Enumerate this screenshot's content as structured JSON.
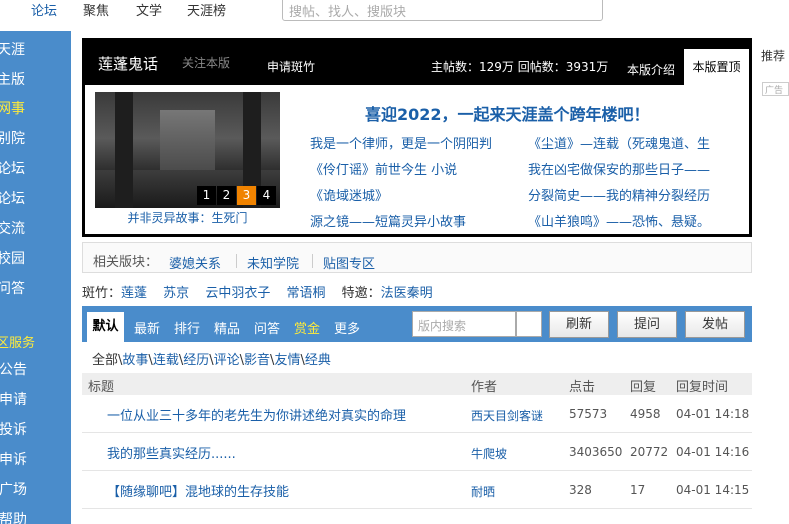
{
  "topnav": {
    "items": [
      "论坛",
      "聚焦",
      "文学",
      "天涯榜"
    ],
    "search_placeholder": "搜帖、找人、搜版块"
  },
  "sidebar": {
    "items": [
      "天涯",
      "主版",
      "网事",
      "别院",
      "论坛",
      "论坛",
      "交流",
      "校园",
      "问答"
    ],
    "section_title": "区服务",
    "service_items": [
      "公告",
      "申请",
      "投诉",
      "申诉",
      "广场",
      "帮助"
    ]
  },
  "board": {
    "title": "莲蓬鬼话",
    "follow_label": "关注本版",
    "apply_label": "申请斑竹",
    "stats": "主帖数：129万 回帖数：3931万",
    "intro_label": "本版介绍",
    "top_label": "本版置顶",
    "slide_numbers": [
      "1",
      "2",
      "3",
      "4"
    ],
    "slide_active": 3,
    "slide_caption": "并非灵异故事：生死门",
    "headline": "喜迎2022，一起来天涯盖个跨年楼吧！",
    "links_left": [
      "我是一个律师，更是一个阴阳判",
      "《伶仃谣》前世今生 小说",
      "《诡域迷城》",
      "源之镜——短篇灵异小故事"
    ],
    "links_right": [
      "《尘道》—连载（死魂鬼道、生",
      "我在凶宅做保安的那些日子——",
      "分裂简史——我的精神分裂经历",
      "《山羊狼鸣》——恐怖、悬疑。"
    ]
  },
  "related": {
    "label": "相关版块：",
    "items": [
      "婆媳关系",
      "未知学院",
      "贴图专区"
    ]
  },
  "moderators": {
    "label": "斑竹：",
    "names": [
      "莲蓬",
      "苏京",
      "云中羽衣子",
      "常语桐"
    ],
    "special_label": "特邀：",
    "special": "法医秦明"
  },
  "tabs": {
    "items": [
      "默认",
      "最新",
      "排行",
      "精品",
      "问答",
      "赏金",
      "更多"
    ],
    "search_placeholder": "版内搜索",
    "refresh": "刷新",
    "ask": "提问",
    "post": "发帖"
  },
  "filters": {
    "all": "全部",
    "items": [
      "故事",
      "连载",
      "经历",
      "评论",
      "影音",
      "友情",
      "经典"
    ]
  },
  "table": {
    "headers": [
      "标题",
      "作者",
      "点击",
      "回复",
      "回复时间"
    ],
    "rows": [
      {
        "title": "一位从业三十多年的老先生为你讲述绝对真实的命理",
        "author": "西天目剑客谜",
        "clicks": "57573",
        "replies": "4958",
        "time": "04-01 14:18"
      },
      {
        "title": "我的那些真实经历......",
        "author": "牛爬坡",
        "clicks": "3403650",
        "replies": "20772",
        "time": "04-01 14:16"
      },
      {
        "title": "【随缘聊吧】混地球的生存技能",
        "author": "耐晒",
        "clicks": "328",
        "replies": "17",
        "time": "04-01 14:15"
      }
    ]
  },
  "right": {
    "label": "推荐",
    "ad": "广告"
  }
}
